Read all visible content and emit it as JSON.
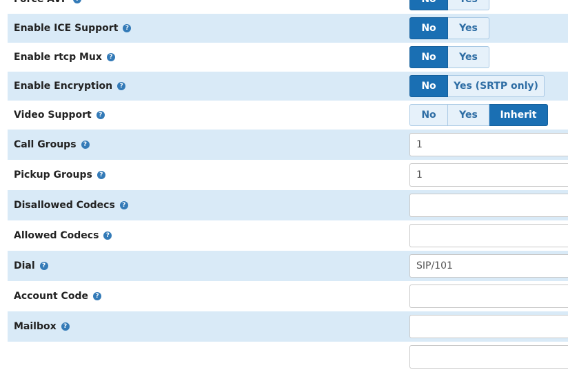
{
  "rows": [
    {
      "label": "Force AVP",
      "type": "toggle",
      "options": [
        "No",
        "Yes"
      ],
      "selected": 0
    },
    {
      "label": "Enable ICE Support",
      "type": "toggle",
      "options": [
        "No",
        "Yes"
      ],
      "selected": 0
    },
    {
      "label": "Enable rtcp Mux",
      "type": "toggle",
      "options": [
        "No",
        "Yes"
      ],
      "selected": 0
    },
    {
      "label": "Enable Encryption",
      "type": "toggle",
      "options": [
        "No",
        "Yes (SRTP only)"
      ],
      "selected": 0
    },
    {
      "label": "Video Support",
      "type": "toggle",
      "options": [
        "No",
        "Yes",
        "Inherit"
      ],
      "selected": 2
    },
    {
      "label": "Call Groups",
      "type": "input",
      "value": "1"
    },
    {
      "label": "Pickup Groups",
      "type": "input",
      "value": "1"
    },
    {
      "label": "Disallowed Codecs",
      "type": "input",
      "value": ""
    },
    {
      "label": "Allowed Codecs",
      "type": "input",
      "value": ""
    },
    {
      "label": "Dial",
      "type": "input",
      "value": "SIP/101"
    },
    {
      "label": "Account Code",
      "type": "input",
      "value": ""
    },
    {
      "label": "Mailbox",
      "type": "input",
      "value": ""
    },
    {
      "label": "",
      "type": "input",
      "value": ""
    }
  ],
  "help_icon_glyph": "?",
  "colors": {
    "stripe": "#d9eaf7",
    "active_button": "#1a6fb3",
    "inactive_button": "#e6f1fa",
    "help_icon": "#337ab7"
  }
}
